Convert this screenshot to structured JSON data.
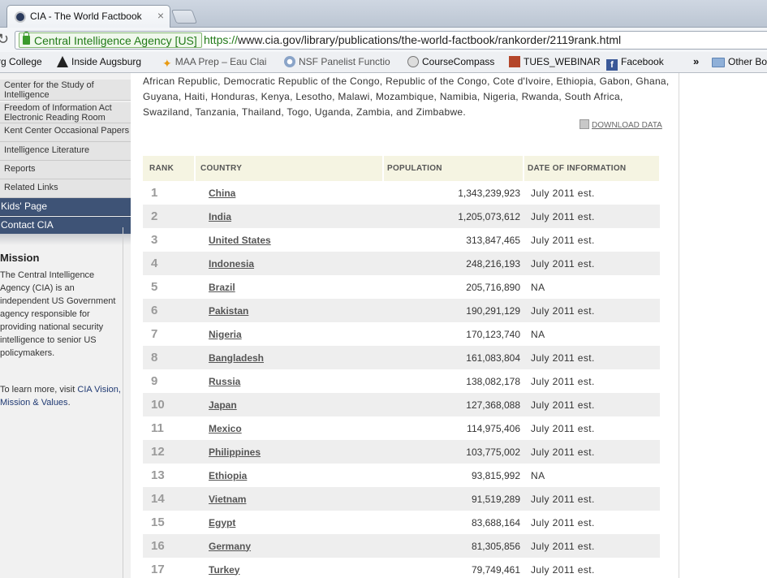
{
  "browser": {
    "tab_title": "CIA - The World Factbook",
    "close_glyph": "×",
    "ev_label": "Central Intelligence Agency [US]",
    "url_scheme": "https://",
    "url_rest": "www.cia.gov/library/publications/the-world-factbook/rankorder/2119rank.html"
  },
  "bookmarks": [
    {
      "label": "rg College",
      "icon": "college-icon"
    },
    {
      "label": "Inside Augsburg",
      "icon": "augsburg-icon"
    },
    {
      "label": "MAA Prep – Eau Clai",
      "icon": "maa-icon"
    },
    {
      "label": "NSF Panelist Functio",
      "icon": "nsf-icon"
    },
    {
      "label": "CourseCompass",
      "icon": "coursecompass-icon"
    },
    {
      "label": "TUES_WEBINAR",
      "icon": "psa-icon"
    },
    {
      "label": "Facebook",
      "icon": "facebook-icon"
    },
    {
      "label": "Other Bo",
      "icon": "folder-icon"
    }
  ],
  "bookmarks_overflow": "»",
  "sidebar": {
    "links": [
      "Center for the Study of Intelligence",
      "Freedom of Information Act Electronic Reading Room",
      "Kent Center Occasional Papers",
      "Intelligence Literature",
      "Reports",
      "Related Links"
    ],
    "kids_page": "Kids' Page",
    "contact": "Contact CIA",
    "mission_title": "Mission",
    "mission_text": "The Central Intelligence Agency (CIA) is an independent US Government agency responsible for providing national security intelligence to senior US policymakers.",
    "more_prefix": "To learn more, visit ",
    "more_link": "CIA Vision, Mission & Values",
    "more_suffix": "."
  },
  "intro_text": "African Republic, Democratic Republic of the Congo, Republic of the Congo, Cote d'Ivoire, Ethiopia, Gabon, Ghana, Guyana, Haiti, Honduras, Kenya, Lesotho, Malawi, Mozambique, Namibia, Nigeria, Rwanda, South Africa, Swaziland, Tanzania, Thailand, Togo, Uganda, Zambia, and Zimbabwe.",
  "download_label": "DOWNLOAD DATA",
  "table": {
    "headers": [
      "RANK",
      "COUNTRY",
      "POPULATION",
      "DATE OF INFORMATION"
    ],
    "rows": [
      {
        "rank": "1",
        "country": "China",
        "population": "1,343,239,923",
        "date": "July 2011 est."
      },
      {
        "rank": "2",
        "country": "India",
        "population": "1,205,073,612",
        "date": "July 2011 est."
      },
      {
        "rank": "3",
        "country": "United States",
        "population": "313,847,465",
        "date": "July 2011 est."
      },
      {
        "rank": "4",
        "country": "Indonesia",
        "population": "248,216,193",
        "date": "July 2011 est."
      },
      {
        "rank": "5",
        "country": "Brazil",
        "population": "205,716,890",
        "date": "NA"
      },
      {
        "rank": "6",
        "country": "Pakistan",
        "population": "190,291,129",
        "date": "July 2011 est."
      },
      {
        "rank": "7",
        "country": "Nigeria",
        "population": "170,123,740",
        "date": "NA"
      },
      {
        "rank": "8",
        "country": "Bangladesh",
        "population": "161,083,804",
        "date": "July 2011 est."
      },
      {
        "rank": "9",
        "country": "Russia",
        "population": "138,082,178",
        "date": "July 2011 est."
      },
      {
        "rank": "10",
        "country": "Japan",
        "population": "127,368,088",
        "date": "July 2011 est."
      },
      {
        "rank": "11",
        "country": "Mexico",
        "population": "114,975,406",
        "date": "July 2011 est."
      },
      {
        "rank": "12",
        "country": "Philippines",
        "population": "103,775,002",
        "date": "July 2011 est."
      },
      {
        "rank": "13",
        "country": "Ethiopia",
        "population": "93,815,992",
        "date": "NA"
      },
      {
        "rank": "14",
        "country": "Vietnam",
        "population": "91,519,289",
        "date": "July 2011 est."
      },
      {
        "rank": "15",
        "country": "Egypt",
        "population": "83,688,164",
        "date": "July 2011 est."
      },
      {
        "rank": "16",
        "country": "Germany",
        "population": "81,305,856",
        "date": "July 2011 est."
      },
      {
        "rank": "17",
        "country": "Turkey",
        "population": "79,749,461",
        "date": "July 2011 est."
      }
    ]
  }
}
